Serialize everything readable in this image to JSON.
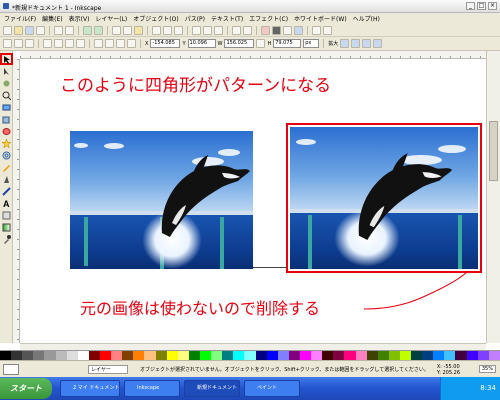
{
  "window": {
    "title": "*新規ドキュメント 1 - Inkscape"
  },
  "menu": [
    "ファイル(F)",
    "編集(E)",
    "表示(V)",
    "レイヤー(L)",
    "オブジェクト(O)",
    "パス(P)",
    "テキスト(T)",
    "エフェクト(C)",
    "ホワイトボード(W)",
    "ヘルプ(H)"
  ],
  "toolbar": {
    "x_value": "-154.085",
    "y_value": "10.096",
    "w_value": "156.025",
    "h_value": "79.075",
    "unit": "px",
    "scale_label": "拡大",
    "x_label": "X",
    "y_label": "Y",
    "w_label": "W",
    "h_label": "H"
  },
  "annotations": {
    "top": "このように四角形がパターンになる",
    "bottom": "元の画像は使わないので削除する"
  },
  "status": {
    "layer": "レイヤー",
    "message": "オブジェクトが選択されていません。オブジェクトをクリック、Shift+クリック、または範囲をドラッグして選択してください。",
    "x_label": "X:",
    "x": "-55.00",
    "y_label": "Y:",
    "y": "205.26",
    "zoom": "35%"
  },
  "taskbar": {
    "start": "スタート",
    "tasks": [
      "2 マイ ドキュメント",
      "Inkscape",
      "新規ドキュメント 1",
      "ペイント"
    ],
    "clock": "8:34"
  },
  "colors": {
    "accent": "#e60012",
    "palette": [
      "#000000",
      "#333333",
      "#555555",
      "#777777",
      "#999999",
      "#bbbbbb",
      "#dddddd",
      "#ffffff",
      "#800000",
      "#ff0000",
      "#ff8080",
      "#804000",
      "#ff8000",
      "#ffc080",
      "#808000",
      "#ffff00",
      "#ffff80",
      "#008000",
      "#00ff00",
      "#80ff80",
      "#008080",
      "#00ffff",
      "#80ffff",
      "#000080",
      "#0000ff",
      "#8080ff",
      "#800080",
      "#ff00ff",
      "#ff80ff",
      "#400000",
      "#800040",
      "#ff0080",
      "#ff80c0",
      "#404000",
      "#408000",
      "#80c000",
      "#c0ff00",
      "#004040",
      "#004080",
      "#0080ff",
      "#40c0ff",
      "#400040",
      "#4000ff",
      "#8040ff",
      "#c080ff"
    ]
  }
}
